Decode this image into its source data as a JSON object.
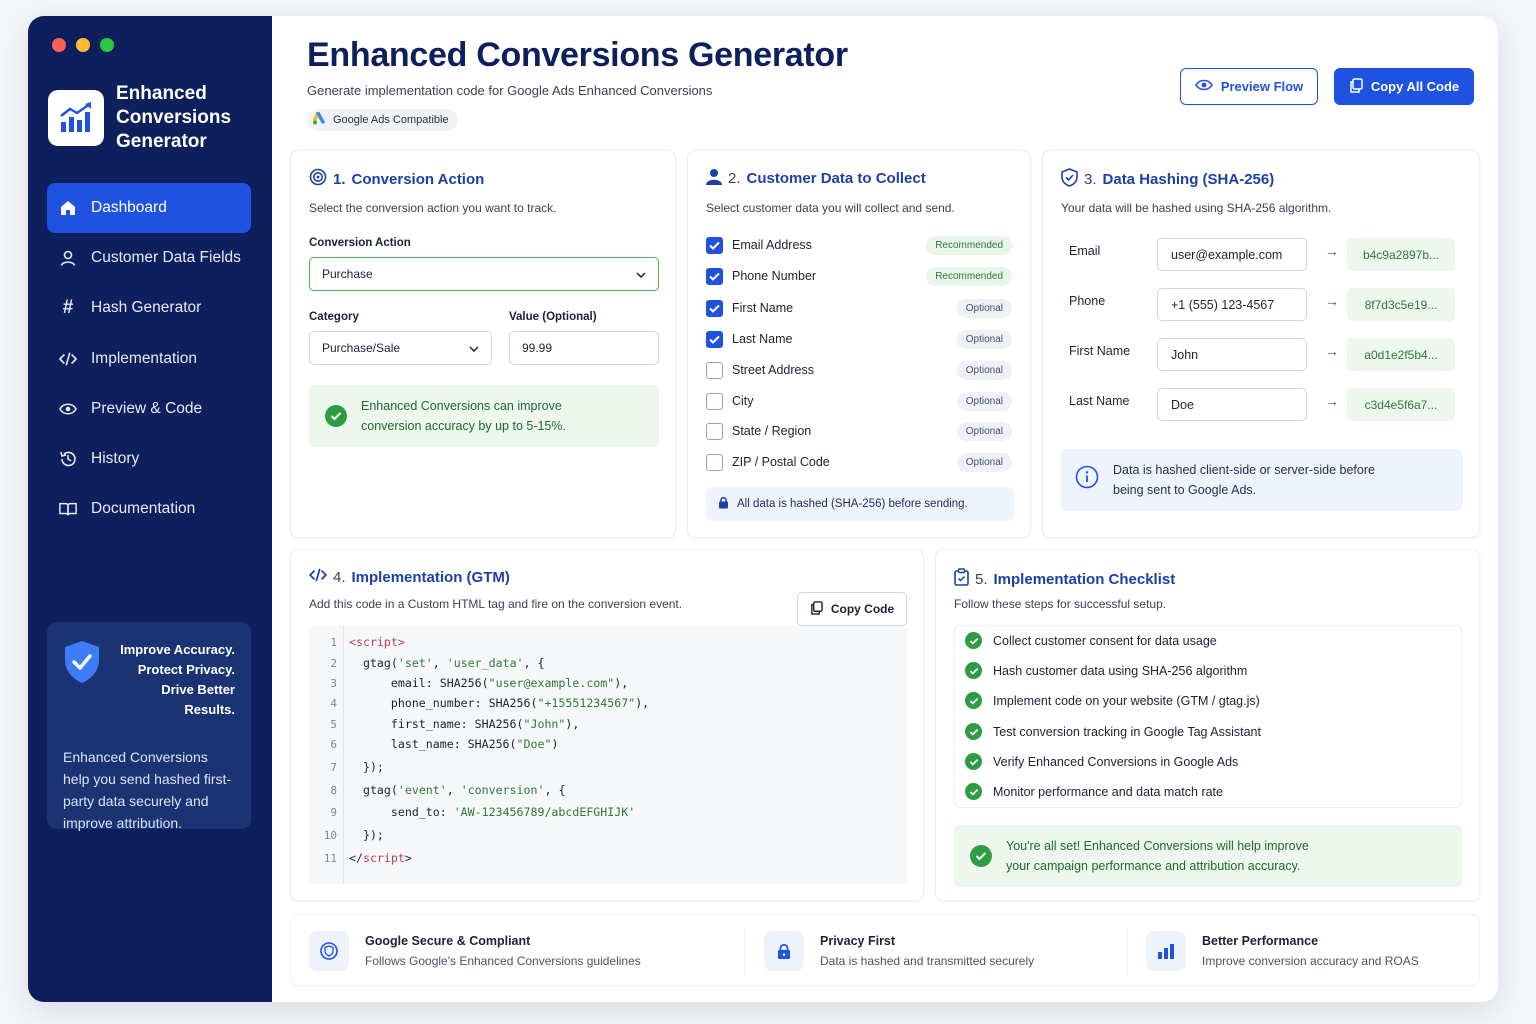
{
  "window": {
    "dot_colors": [
      "#ff5f57",
      "#febc2e",
      "#28c840"
    ]
  },
  "sidebar": {
    "brand": "Enhanced Conversions Generator",
    "items": [
      {
        "label": "Dashboard",
        "icon": "home-icon",
        "active": true
      },
      {
        "label": "Customer Data Fields",
        "icon": "user-icon"
      },
      {
        "label": "Hash Generator",
        "icon": "hash-icon"
      },
      {
        "label": "Implementation",
        "icon": "code-icon"
      },
      {
        "label": "Preview & Code",
        "icon": "eye-icon"
      },
      {
        "label": "History",
        "icon": "history-icon"
      },
      {
        "label": "Documentation",
        "icon": "book-icon"
      }
    ],
    "promo": {
      "heading": [
        "Improve Accuracy.",
        "Protect Privacy.",
        "Drive Better Results."
      ],
      "body": "Enhanced Conversions help you send hashed first-party data securely and improve attribution."
    }
  },
  "header": {
    "title": "Enhanced Conversions Generator",
    "subtitle": "Generate implementation code for Google Ads Enhanced Conversions",
    "badge": "Google Ads Compatible",
    "preview_button": "Preview Flow",
    "copy_all_button": "Copy All Code"
  },
  "conversion": {
    "num": "1.",
    "title": "Conversion Action",
    "desc": "Select the conversion action you want to track.",
    "action_label": "Conversion Action",
    "action_value": "Purchase",
    "category_label": "Category",
    "category_value": "Purchase/Sale",
    "value_label": "Value (Optional)",
    "value_value": "99.99",
    "tip_line1": "Enhanced Conversions can improve",
    "tip_line2": "conversion accuracy by up to 5-15%."
  },
  "customer": {
    "num": "2.",
    "title": "Customer Data to Collect",
    "desc": "Select customer data you will collect and send.",
    "fields": [
      {
        "label": "Email Address",
        "checked": true,
        "tag": "Recommended"
      },
      {
        "label": "Phone Number",
        "checked": true,
        "tag": "Recommended"
      },
      {
        "label": "First Name",
        "checked": true,
        "tag": "Optional"
      },
      {
        "label": "Last Name",
        "checked": true,
        "tag": "Optional"
      },
      {
        "label": "Street Address",
        "checked": false,
        "tag": "Optional"
      },
      {
        "label": "City",
        "checked": false,
        "tag": "Optional"
      },
      {
        "label": "State / Region",
        "checked": false,
        "tag": "Optional"
      },
      {
        "label": "ZIP / Postal Code",
        "checked": false,
        "tag": "Optional"
      }
    ],
    "note": "All data is hashed (SHA-256) before sending."
  },
  "hashing": {
    "num": "3.",
    "title": "Data Hashing (SHA-256)",
    "desc": "Your data will be hashed using SHA-256 algorithm.",
    "rows": [
      {
        "label": "Email",
        "input": "user@example.com",
        "hash": "b4c9a2897b..."
      },
      {
        "label": "Phone",
        "input": "+1 (555) 123-4567",
        "hash": "8f7d3c5e19..."
      },
      {
        "label": "First Name",
        "input": "John",
        "hash": "a0d1e2f5b4..."
      },
      {
        "label": "Last Name",
        "input": "Doe",
        "hash": "c3d4e5f6a7..."
      }
    ],
    "info_line1": "Data is hashed client-side or server-side before",
    "info_line2": "being sent to Google Ads."
  },
  "implementation": {
    "num": "4.",
    "title": "Implementation (GTM)",
    "desc": "Add this code in a Custom HTML tag and fire on the conversion event.",
    "copy_button": "Copy Code",
    "lines": [
      "1",
      "2",
      "3",
      "4",
      "5",
      "6",
      "7",
      "8",
      "9",
      "10",
      "11"
    ]
  },
  "checklist": {
    "num": "5.",
    "title": "Implementation Checklist",
    "desc": "Follow these steps for successful setup.",
    "items": [
      "Collect customer consent for data usage",
      "Hash customer data using SHA-256 algorithm",
      "Implement code on your website (GTM / gtag.js)",
      "Test conversion tracking in Google Tag Assistant",
      "Verify Enhanced Conversions in Google Ads",
      "Monitor performance and data match rate"
    ],
    "done_line1": "You're all set! Enhanced Conversions will help improve",
    "done_line2": "your campaign performance and attribution accuracy."
  },
  "features": [
    {
      "title": "Google Secure & Compliant",
      "desc": "Follows Google's Enhanced Conversions guidelines",
      "icon": "shield-check-icon"
    },
    {
      "title": "Privacy First",
      "desc": "Data is hashed and transmitted securely",
      "icon": "lock-icon"
    },
    {
      "title": "Better Performance",
      "desc": "Improve conversion accuracy and ROAS",
      "icon": "bar-chart-icon"
    }
  ],
  "colors": {
    "sidebar": "#0d1f5c",
    "accent": "#1f52e0",
    "success": "#2e9c43"
  }
}
